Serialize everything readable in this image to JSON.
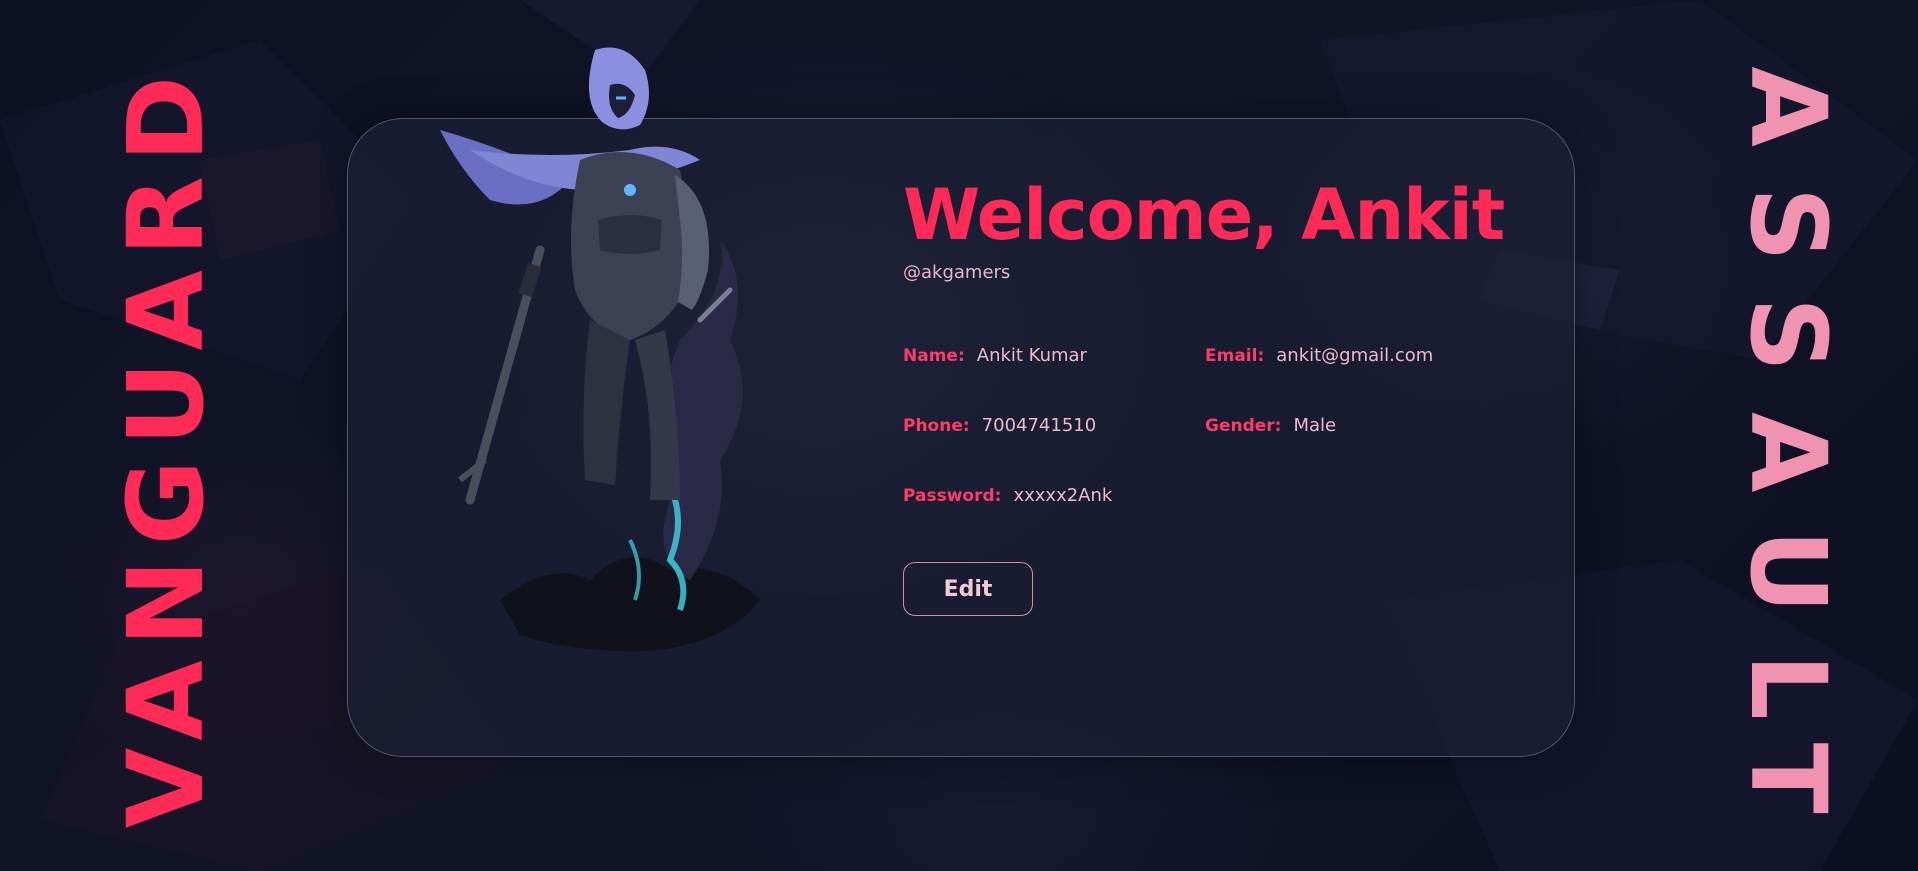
{
  "background": {
    "base_color": "#0c0d1f",
    "theme": "dark navy"
  },
  "side_titles": {
    "left": "VANGUARD",
    "right": "ASSAULT",
    "left_color": "#ff2a55",
    "right_color": "#ef93b0"
  },
  "profile": {
    "welcome": "Welcome, Ankit",
    "handle": "@akgamers",
    "fields": [
      {
        "label": "Name:",
        "value": "Ankit Kumar"
      },
      {
        "label": "Email:",
        "value": "ankit@gmail.com"
      },
      {
        "label": "Phone:",
        "value": "7004741510"
      },
      {
        "label": "Gender:",
        "value": "Male"
      },
      {
        "label": "Password:",
        "value": "xxxxx2Ank"
      }
    ],
    "edit_label": "Edit",
    "accent_color": "#ff2a55"
  },
  "agent_icon": "hooded-agent-illustration"
}
